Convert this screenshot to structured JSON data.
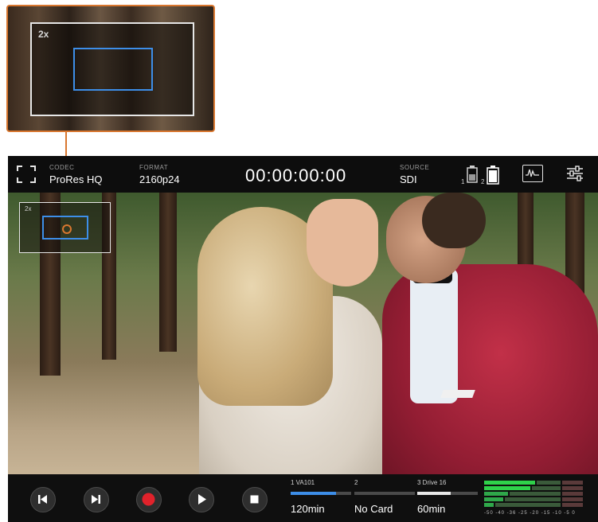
{
  "callout": {
    "zoom_label": "2x"
  },
  "topbar": {
    "codec_label": "CODEC",
    "codec_value": "ProRes HQ",
    "format_label": "FORMAT",
    "format_value": "2160p24",
    "timecode": "00:00:00:00",
    "source_label": "SOURCE",
    "source_value": "SDI",
    "battery_1": "1",
    "battery_2": "2"
  },
  "overlay": {
    "zoom_label": "2x"
  },
  "transport": {
    "buttons": [
      "skip-back",
      "skip-forward",
      "record",
      "play",
      "stop"
    ],
    "record_color": "#e1222b"
  },
  "media": [
    {
      "label": "1  VA101",
      "value": "120min",
      "fill": 0.75,
      "color": "#3d8ee8"
    },
    {
      "label": "2",
      "value": "No Card",
      "fill": 0.0,
      "color": "#4a4a4a"
    },
    {
      "label": "3  Drive 16",
      "value": "60min",
      "fill": 0.55,
      "color": "#e8e8e8"
    }
  ],
  "meters": {
    "scale": "-50 -40 -36 -25 -20 -15 -10 -5 0"
  },
  "colors": {
    "accent": "#3d8ee8",
    "callout": "#d9772f"
  }
}
